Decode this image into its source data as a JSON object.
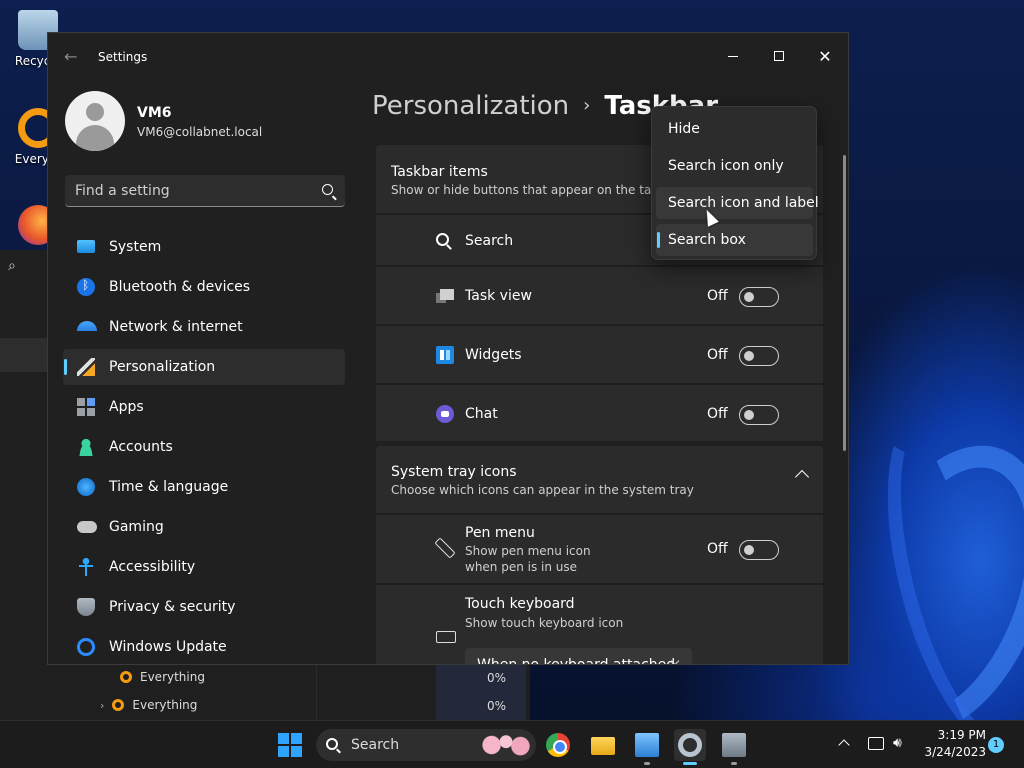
{
  "desktop": {
    "icons": [
      {
        "label": "Recycle"
      },
      {
        "label": "Everyth"
      },
      {
        "label": ""
      }
    ],
    "background_rows": [
      {
        "label": "Everything",
        "pct": "0%"
      },
      {
        "label": "Everything",
        "pct": "0%"
      }
    ]
  },
  "window": {
    "title": "Settings",
    "user": {
      "name": "VM6",
      "email": "VM6@collabnet.local"
    },
    "search": {
      "placeholder": "Find a setting"
    }
  },
  "nav": {
    "items": [
      {
        "label": "System",
        "icon": "system-icon"
      },
      {
        "label": "Bluetooth & devices",
        "icon": "bluetooth-icon"
      },
      {
        "label": "Network & internet",
        "icon": "wifi-icon"
      },
      {
        "label": "Personalization",
        "icon": "brush-icon",
        "selected": true
      },
      {
        "label": "Apps",
        "icon": "apps-icon"
      },
      {
        "label": "Accounts",
        "icon": "person-icon"
      },
      {
        "label": "Time & language",
        "icon": "globe-clock-icon"
      },
      {
        "label": "Gaming",
        "icon": "gamepad-icon"
      },
      {
        "label": "Accessibility",
        "icon": "accessibility-icon"
      },
      {
        "label": "Privacy & security",
        "icon": "shield-icon"
      },
      {
        "label": "Windows Update",
        "icon": "update-icon"
      }
    ]
  },
  "breadcrumb": {
    "parent": "Personalization",
    "separator": "›",
    "current": "Taskbar"
  },
  "taskbar_items": {
    "title": "Taskbar items",
    "subtitle": "Show or hide buttons that appear on the taskba",
    "rows": [
      {
        "label": "Search"
      },
      {
        "label": "Task view",
        "state": "Off"
      },
      {
        "label": "Widgets",
        "state": "Off"
      },
      {
        "label": "Chat",
        "state": "Off"
      }
    ]
  },
  "system_tray": {
    "title": "System tray icons",
    "subtitle": "Choose which icons can appear in the system tray",
    "pen": {
      "label": "Pen menu",
      "desc1": "Show pen menu icon",
      "desc2": "when pen is in use",
      "state": "Off"
    },
    "touch": {
      "label": "Touch keyboard",
      "desc": "Show touch keyboard icon",
      "select_value": "When no keyboard attached"
    }
  },
  "dropdown": {
    "options": [
      {
        "label": "Hide"
      },
      {
        "label": "Search icon only"
      },
      {
        "label": "Search icon and label",
        "hover": true
      },
      {
        "label": "Search box",
        "selected": true
      }
    ]
  },
  "taskbar": {
    "search_label": "Search",
    "time": "3:19 PM",
    "date": "3/24/2023",
    "notifications": "1"
  },
  "colors": {
    "accent": "#60cdff",
    "window_bg": "#202020",
    "card_bg": "#2b2b2b"
  }
}
